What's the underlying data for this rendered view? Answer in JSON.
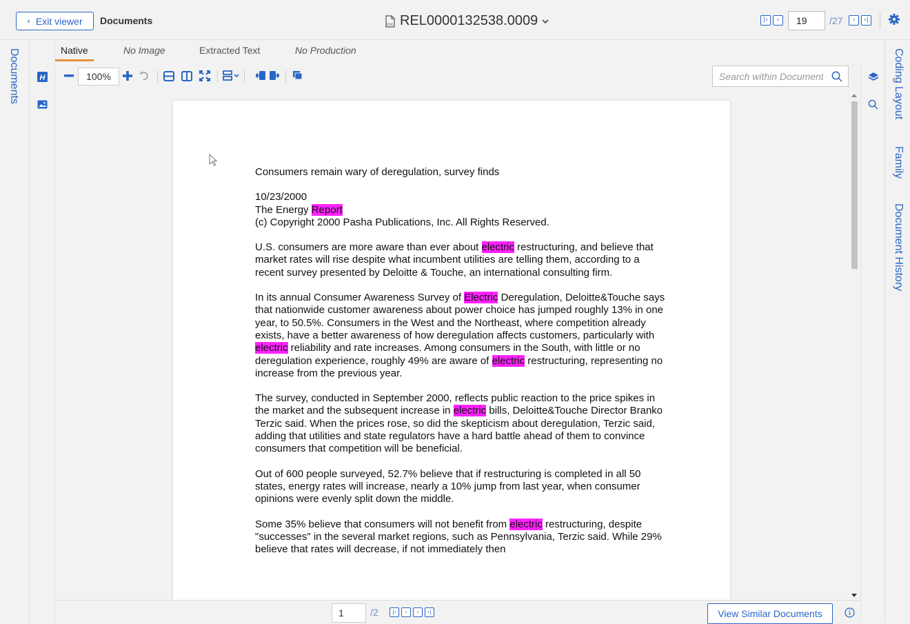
{
  "header": {
    "exit_label": "Exit viewer",
    "breadcrumb": "Documents",
    "doc_id": "REL0000132538.0009",
    "current_doc": "19",
    "total_docs": "/27"
  },
  "left_rail": {
    "label": "Documents"
  },
  "tabs": [
    "Native",
    "No Image",
    "Extracted Text",
    "No Production"
  ],
  "toolbar": {
    "zoom": "100%",
    "search_placeholder": "Search within Document"
  },
  "document": {
    "lines": [
      {
        "id": "title",
        "segments": [
          {
            "t": "Consumers remain wary of deregulation, survey finds"
          }
        ]
      },
      {
        "id": "date",
        "segments": [
          {
            "t": "10/23/2000"
          }
        ]
      },
      {
        "id": "pub",
        "segments": [
          {
            "t": "The Energy "
          },
          {
            "t": "Report",
            "hl": true
          }
        ]
      },
      {
        "id": "copy",
        "segments": [
          {
            "t": "(c) Copyright 2000 Pasha Publications, Inc. All Rights Reserved."
          }
        ]
      }
    ],
    "paragraphs": [
      [
        {
          "t": "U.S. consumers are more aware than ever about "
        },
        {
          "t": "electric",
          "hl": true
        },
        {
          "t": " restructuring, and believe that market rates will rise despite what incumbent utilities are telling them, according to a recent survey presented by Deloitte & Touche, an international consulting firm."
        }
      ],
      [
        {
          "t": "In its annual Consumer Awareness Survey of "
        },
        {
          "t": "Electric",
          "hl": true
        },
        {
          "t": " Deregulation, Deloitte&Touche says that nationwide customer awareness about power choice has jumped roughly 13% in one year, to 50.5%. Consumers in the West and the Northeast, where competition already exists, have a better awareness of how deregulation affects customers, particularly with "
        },
        {
          "t": "electric",
          "hl": true
        },
        {
          "t": " reliability and rate increases. Among consumers in the South, with little or no deregulation experience, roughly 49% are aware of "
        },
        {
          "t": "electric",
          "hl": true
        },
        {
          "t": " restructuring, representing no increase from the previous year."
        }
      ],
      [
        {
          "t": "The survey, conducted in September 2000, reflects public reaction to the price spikes in the market and the subsequent increase in "
        },
        {
          "t": "electric",
          "hl": true
        },
        {
          "t": " bills, Deloitte&Touche Director Branko Terzic said. When the prices rose, so did the skepticism about deregulation, Terzic said, adding that utilities and state regulators have a hard battle ahead of them to convince consumers that competition will be beneficial."
        }
      ],
      [
        {
          "t": "Out of 600 people surveyed, 52.7% believe that if restructuring is completed in all 50 states, energy rates will increase, nearly a 10% jump from last year, when consumer opinions were evenly split down the middle."
        }
      ],
      [
        {
          "t": "Some 35% believe that consumers will not benefit from "
        },
        {
          "t": "electric",
          "hl": true
        },
        {
          "t": " restructuring, despite \"successes\" in the several market regions, such as Pennsylvania, Terzic said. While 29% believe that rates will decrease, if not immediately then"
        }
      ]
    ]
  },
  "right_rail": [
    "Coding Layout",
    "Family",
    "Document History"
  ],
  "bottom": {
    "current_page": "1",
    "total_pages": "/2",
    "similar_label": "View Similar Documents"
  },
  "colors": {
    "accent": "#2a66c6",
    "highlight": "#ff22ff",
    "tab_underline": "#e8913a"
  }
}
